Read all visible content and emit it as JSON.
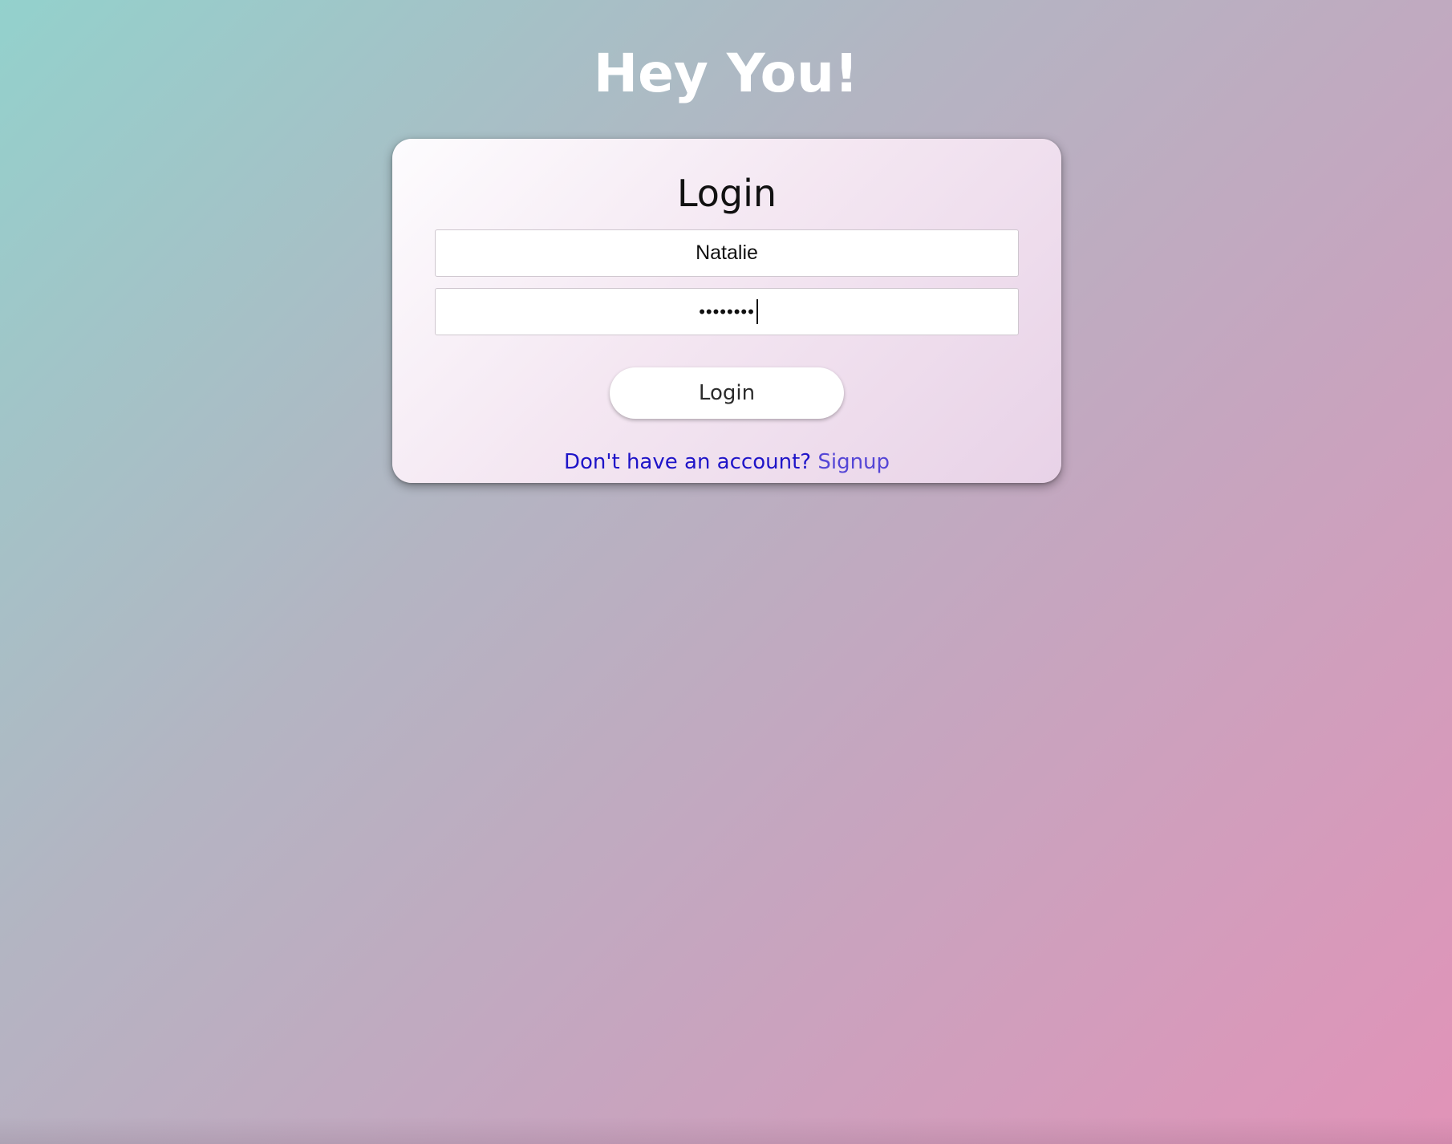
{
  "header": {
    "title": "Hey You!"
  },
  "login_form": {
    "title": "Login",
    "username_value": "Natalie",
    "password_value": "••••••••",
    "login_button_label": "Login",
    "signup_prompt": "Don't have an account?",
    "signup_link_label": "Signup"
  },
  "colors": {
    "background_top_left": "#93d1cc",
    "background_bottom_right": "#e193b8",
    "prompt_text": "#1e14c8",
    "signup_link": "#5546d6"
  }
}
